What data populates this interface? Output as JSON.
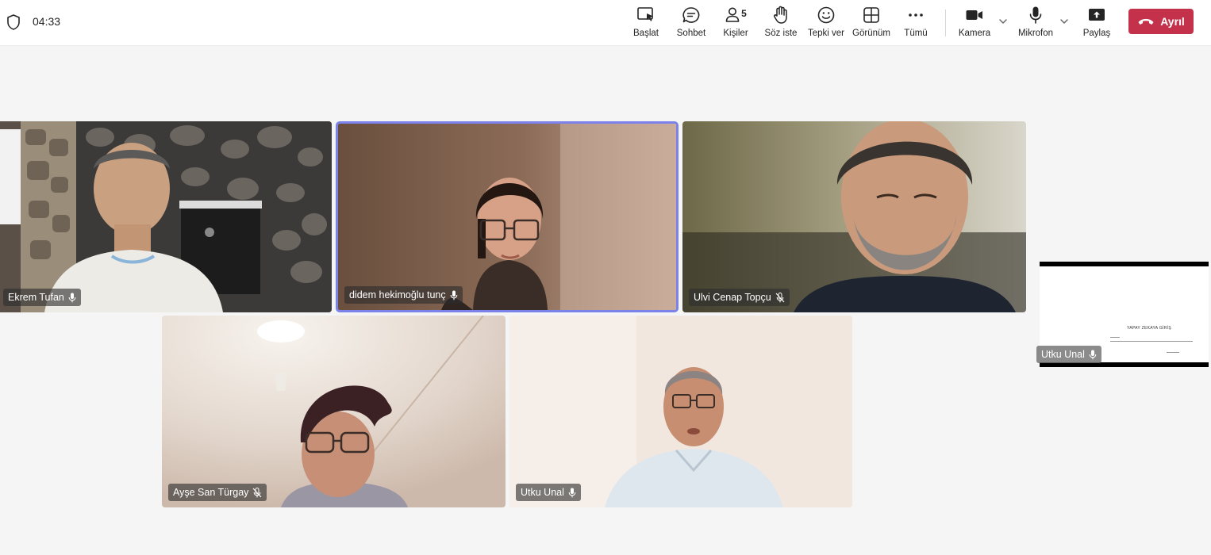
{
  "meeting": {
    "elapsed_time": "04:33"
  },
  "toolbar": {
    "start_label": "Başlat",
    "chat_label": "Sohbet",
    "people_label": "Kişiler",
    "people_count": "5",
    "raise_hand_label": "Söz iste",
    "react_label": "Tepki ver",
    "view_label": "Görünüm",
    "more_label": "Tümü",
    "camera_label": "Kamera",
    "mic_label": "Mikrofon",
    "share_label": "Paylaş",
    "leave_label": "Ayrıl"
  },
  "participants": [
    {
      "name": "Ekrem Tufan",
      "mic": "on"
    },
    {
      "name": "didem hekimoğlu tunç",
      "mic": "on",
      "active_speaker": true
    },
    {
      "name": "Ulvi Cenap Topçu",
      "mic": "muted"
    },
    {
      "name": "Ayşe San Türgay",
      "mic": "muted"
    },
    {
      "name": "Utku Unal",
      "mic": "on"
    }
  ],
  "screen_share": {
    "presenter": "Utku Unal",
    "slide_title": "YAPAY ZEKAYA GİRİŞ"
  },
  "colors": {
    "leave_button": "#c4314b",
    "active_speaker_border": "#7b83eb",
    "topbar_bg": "#ffffff",
    "stage_bg": "#f5f5f5"
  }
}
